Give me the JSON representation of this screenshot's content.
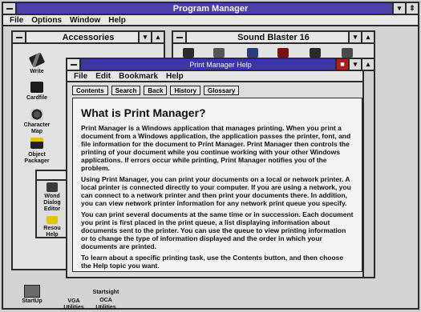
{
  "program_manager": {
    "title": "Program Manager",
    "menu": [
      "File",
      "Options",
      "Window",
      "Help"
    ]
  },
  "accessories": {
    "title": "Accessories",
    "icons": [
      {
        "label": "Write",
        "icon": "write-pen-icon"
      },
      {
        "label": "Cardfile",
        "icon": "cardfile-icon"
      },
      {
        "label": "Character Map",
        "icon": "character-map-icon"
      },
      {
        "label": "Object Packager",
        "icon": "object-packager-icon"
      }
    ],
    "partial_labels": [
      "Wond",
      "Dialog",
      "Editor",
      "Resou",
      "Help"
    ]
  },
  "sound_blaster": {
    "title": "Sound Blaster 16"
  },
  "help_window": {
    "title": "Print Manager Help",
    "menu": [
      "File",
      "Edit",
      "Bookmark",
      "Help"
    ],
    "buttons": [
      "Contents",
      "Search",
      "Back",
      "History",
      "Glossary"
    ],
    "heading": "What is Print Manager?",
    "paragraphs": [
      "Print Manager is a Windows application that manages printing. When you print a document from a Windows application, the application passes the printer, font, and file information for the document to Print Manager. Print Manager then controls the printing of your document while you continue working with your other Windows applications. If errors occur while printing, Print Manager notifies you of the problem.",
      "Using Print Manager, you can print your documents on a local or network printer. A local printer is connected directly to your computer. If you are using a network, you can connect to a network printer and then print your documents there. In addition, you can view network printer information for any network print queue you specify.",
      "You can print several documents at the same time or in succession. Each document you print is first placed in the print queue, a list displaying information about documents sent to the printer. You can use the queue to view printing information or to change the type of information displayed and the order in which your documents are printed.",
      "To learn about a specific printing task, use the Contents button, and then choose the Help topic you want."
    ]
  },
  "bottom": {
    "startup_label": "StartUp",
    "labels": [
      "VGA Utilities",
      "Startsight",
      "OCA",
      "Utilities"
    ]
  }
}
